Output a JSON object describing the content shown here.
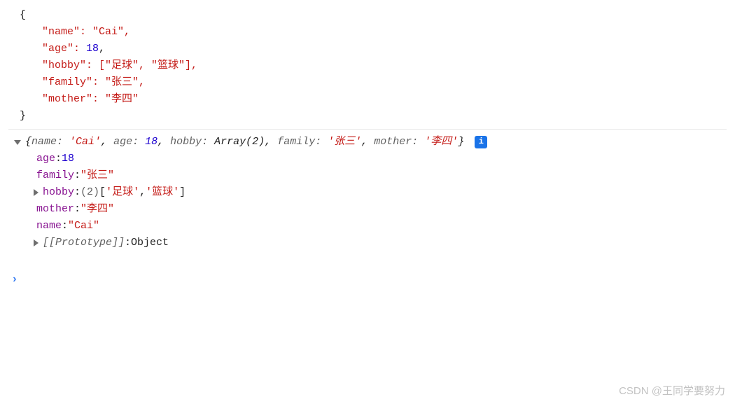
{
  "json": {
    "open": "{",
    "lines": {
      "name": "\"name\": \"Cai\",",
      "age_k": "\"age\": ",
      "age_v": "18",
      "age_t": ",",
      "hobby": "\"hobby\": [\"足球\", \"篮球\"],",
      "family": "\"family\": \"张三\",",
      "mother": "\"mother\": \"李四\""
    },
    "close": "}"
  },
  "summary": {
    "open": "{",
    "k_name": "name:",
    "v_name": "'Cai'",
    "k_age": "age:",
    "v_age": "18",
    "k_hobby": "hobby:",
    "v_hobby": "Array(2)",
    "k_family": "family:",
    "v_family": "'张三'",
    "k_mother": "mother:",
    "v_mother": "'李四'",
    "close": "}",
    "info": "i"
  },
  "props": {
    "age_k": "age",
    "age_v": "18",
    "family_k": "family",
    "family_v": "\"张三\"",
    "hobby_k": "hobby",
    "hobby_count": "(2) ",
    "hobby_arr_open": "[",
    "hobby_v1": "'足球'",
    "hobby_sep": ", ",
    "hobby_v2": "'篮球'",
    "hobby_arr_close": "]",
    "mother_k": "mother",
    "mother_v": "\"李四\"",
    "name_k": "name",
    "name_v": "\"Cai\"",
    "proto_k": "[[Prototype]]",
    "proto_v": "Object",
    "colon": ": "
  },
  "prompt": "›",
  "watermark": "CSDN @王同学要努力"
}
